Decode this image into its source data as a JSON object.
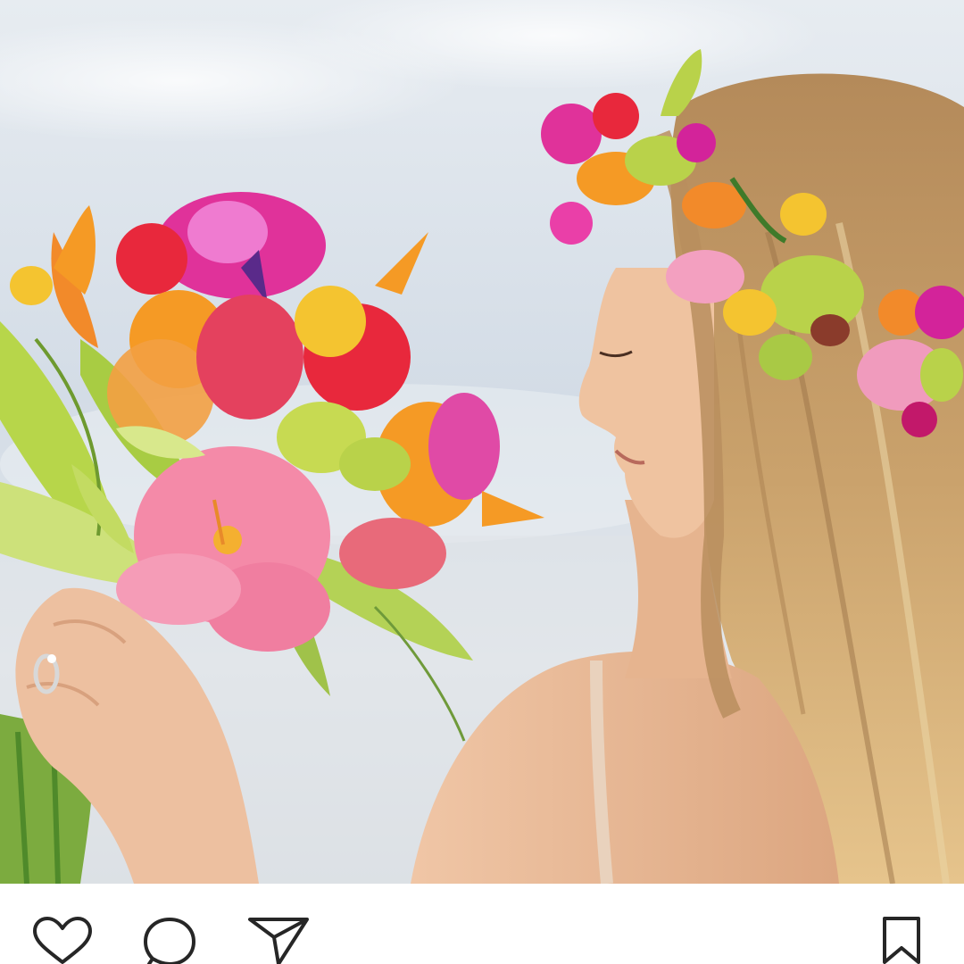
{
  "post": {
    "photo": {
      "icon": "photo",
      "colors": {
        "sky": "#dbe3ea",
        "skin": "#e8b898",
        "hair": "#c9a06a",
        "hibiscus": "#f48aa8",
        "orchid": "#e0329a",
        "leaf": "#a9c945",
        "orange": "#f59a25",
        "red": "#e8283c"
      }
    },
    "actions": {
      "like": {
        "icon": "heart-icon"
      },
      "comment": {
        "icon": "comment-bubble-icon"
      },
      "share": {
        "icon": "paper-plane-icon"
      },
      "save": {
        "icon": "bookmark-icon"
      }
    },
    "icon_color": "#262626"
  }
}
